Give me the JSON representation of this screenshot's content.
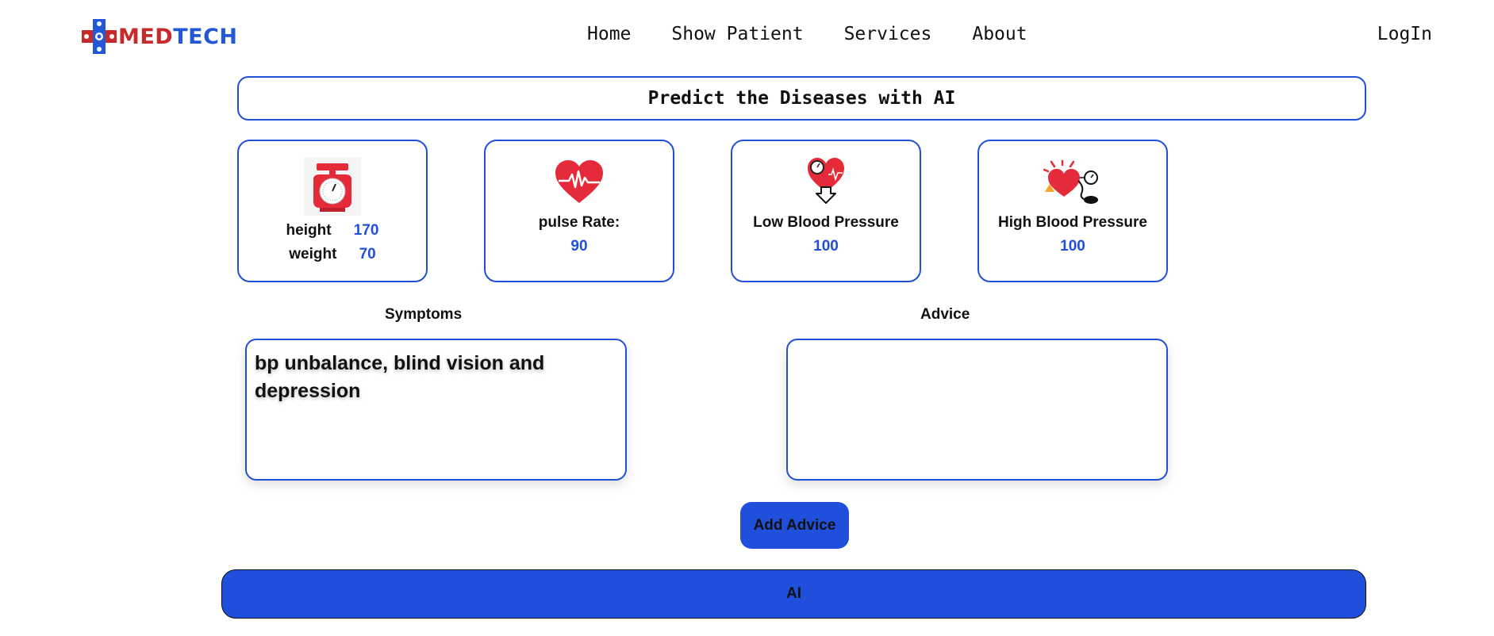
{
  "brand": {
    "part1": "MED",
    "part2": "TECH"
  },
  "nav": {
    "links": [
      "Home",
      "Show Patient",
      "Services",
      "About"
    ],
    "login": "LogIn"
  },
  "title": "Predict the Diseases with AI",
  "cards": {
    "body": {
      "height_label": "height",
      "height_value": "170",
      "weight_label": "weight",
      "weight_value": "70"
    },
    "pulse": {
      "label": "pulse Rate:",
      "value": "90"
    },
    "low_bp": {
      "label": "Low Blood Pressure",
      "value": "100"
    },
    "high_bp": {
      "label": "High Blood Pressure",
      "value": "100"
    }
  },
  "symptoms": {
    "label": "Symptoms",
    "value": "bp unbalance, blind vision and depression"
  },
  "advice": {
    "label": "Advice",
    "value": ""
  },
  "buttons": {
    "add_advice": "Add Advice",
    "ai": "AI"
  },
  "colors": {
    "accent": "#2150d8",
    "brand_red": "#c62a2a",
    "brand_blue": "#2257d6",
    "icon_red": "#e52b3a"
  },
  "icons": {
    "logo": "medical-cross-icon",
    "scale": "weight-scale-icon",
    "pulse": "heart-pulse-icon",
    "low_bp": "heart-down-arrow-icon",
    "high_bp": "heart-gauge-icon"
  }
}
